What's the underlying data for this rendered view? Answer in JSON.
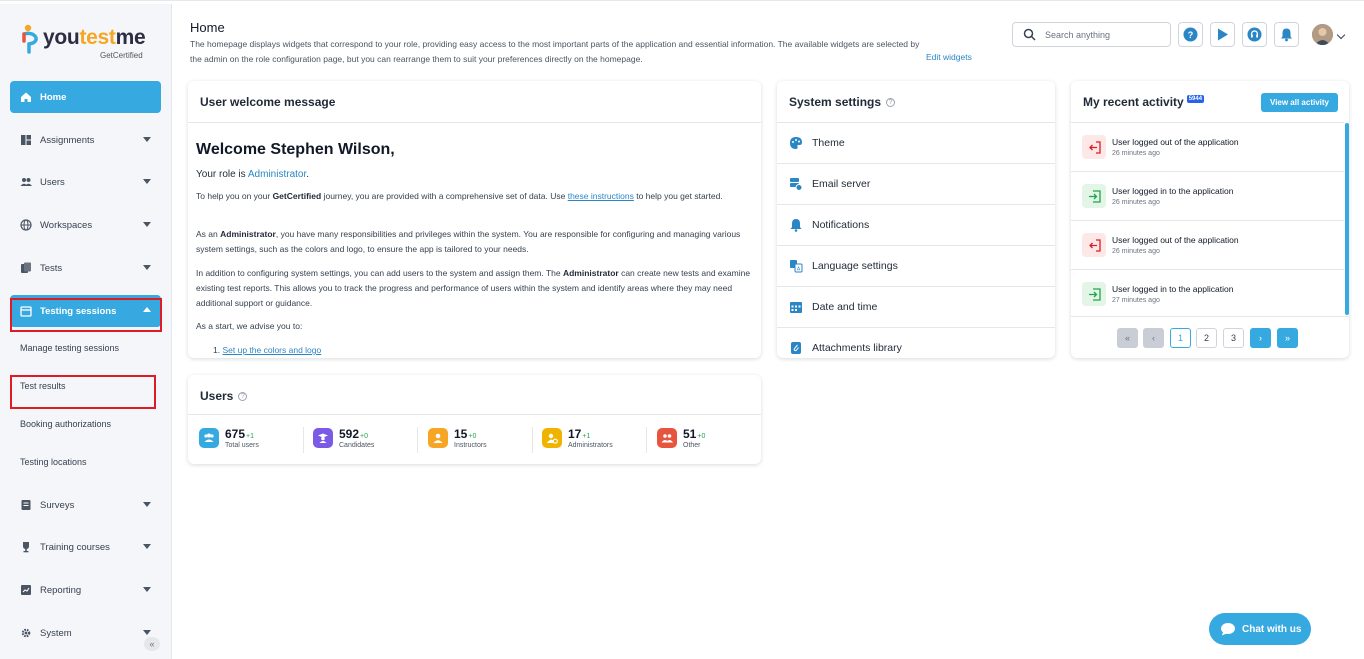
{
  "brand": {
    "name_a": "you",
    "name_b": "test",
    "name_c": "me",
    "sub": "GetCertified"
  },
  "sidebar": {
    "items": [
      {
        "label": "Home",
        "icon": "home-icon"
      },
      {
        "label": "Assignments",
        "icon": "assignments-icon"
      },
      {
        "label": "Users",
        "icon": "users-icon"
      },
      {
        "label": "Workspaces",
        "icon": "globe-icon"
      },
      {
        "label": "Tests",
        "icon": "tests-icon"
      },
      {
        "label": "Testing sessions",
        "icon": "calendar-icon"
      },
      {
        "label": "Surveys",
        "icon": "survey-icon"
      },
      {
        "label": "Training courses",
        "icon": "trophy-icon"
      },
      {
        "label": "Reporting",
        "icon": "chart-icon"
      },
      {
        "label": "System",
        "icon": "gear-icon"
      }
    ],
    "sub_items": [
      "Manage testing sessions",
      "Test results",
      "Booking authorizations",
      "Testing locations"
    ]
  },
  "header": {
    "title": "Home",
    "description": "The homepage displays widgets that correspond to your role, providing easy access to the most important parts of the application and essential information. The available widgets are selected by the admin on the role configuration page, but you can rearrange them to suit your preferences directly on the homepage.",
    "edit_widgets": "Edit widgets",
    "search_placeholder": "Search anything"
  },
  "welcome": {
    "card_title": "User welcome message",
    "heading": "Welcome Stephen Wilson,",
    "role_prefix": "Your role is ",
    "role": "Administrator",
    "role_suffix": ".",
    "p1_a": "To help you on your ",
    "p1_b": "GetCertified",
    "p1_c": " journey, you are provided with a comprehensive set of data. Use ",
    "p1_link": "these instructions",
    "p1_d": " to help you get started.",
    "p2_a": "As an ",
    "p2_b": "Administrator",
    "p2_c": ", you have many responsibilities and privileges within the system. You are responsible for configuring and managing various system settings, such as the colors and logo, to ensure the app is tailored to your needs.",
    "p3_a": "In addition to configuring system settings, you can add users to the system and assign them. The ",
    "p3_b": "Administrator",
    "p3_c": " can create new tests and examine existing test reports. This allows you to track the progress and performance of users within the system and identify areas where they may need additional support or guidance.",
    "p4": "As a start, we advise you to:",
    "list_num": "1.",
    "list_link": "Set up the colors and logo"
  },
  "settings": {
    "title": "System settings",
    "rows": [
      {
        "label": "Theme",
        "icon": "palette-icon"
      },
      {
        "label": "Email server",
        "icon": "email-server-icon"
      },
      {
        "label": "Notifications",
        "icon": "bell-icon"
      },
      {
        "label": "Language settings",
        "icon": "language-icon"
      },
      {
        "label": "Date and time",
        "icon": "calendar-icon"
      },
      {
        "label": "Attachments library",
        "icon": "attachment-icon"
      }
    ]
  },
  "activity": {
    "title": "My recent activity",
    "badge": "5944",
    "view_all": "View all activity",
    "rows": [
      {
        "text": "User logged out of the application",
        "time": "26 minutes ago",
        "kind": "logout"
      },
      {
        "text": "User logged in to the application",
        "time": "26 minutes ago",
        "kind": "login"
      },
      {
        "text": "User logged out of the application",
        "time": "26 minutes ago",
        "kind": "logout"
      },
      {
        "text": "User logged in to the application",
        "time": "27 minutes ago",
        "kind": "login"
      }
    ],
    "pages": [
      "1",
      "2",
      "3"
    ],
    "first": "«",
    "prev": "‹",
    "next": "›",
    "last": "»"
  },
  "users": {
    "title": "Users",
    "stats": [
      {
        "count": "675",
        "delta": "+1",
        "label": "Total users",
        "color": "#36a9e1"
      },
      {
        "count": "592",
        "delta": "+0",
        "label": "Candidates",
        "color": "#7b5be6"
      },
      {
        "count": "15",
        "delta": "+0",
        "label": "Instructors",
        "color": "#f6a623"
      },
      {
        "count": "17",
        "delta": "+1",
        "label": "Administrators",
        "color": "#f0b400"
      },
      {
        "count": "51",
        "delta": "+0",
        "label": "Other",
        "color": "#e8553e"
      }
    ]
  },
  "chat": {
    "label": "Chat with us"
  },
  "colors": {
    "accent": "#36a9e1",
    "highlight": "#e01b24"
  }
}
